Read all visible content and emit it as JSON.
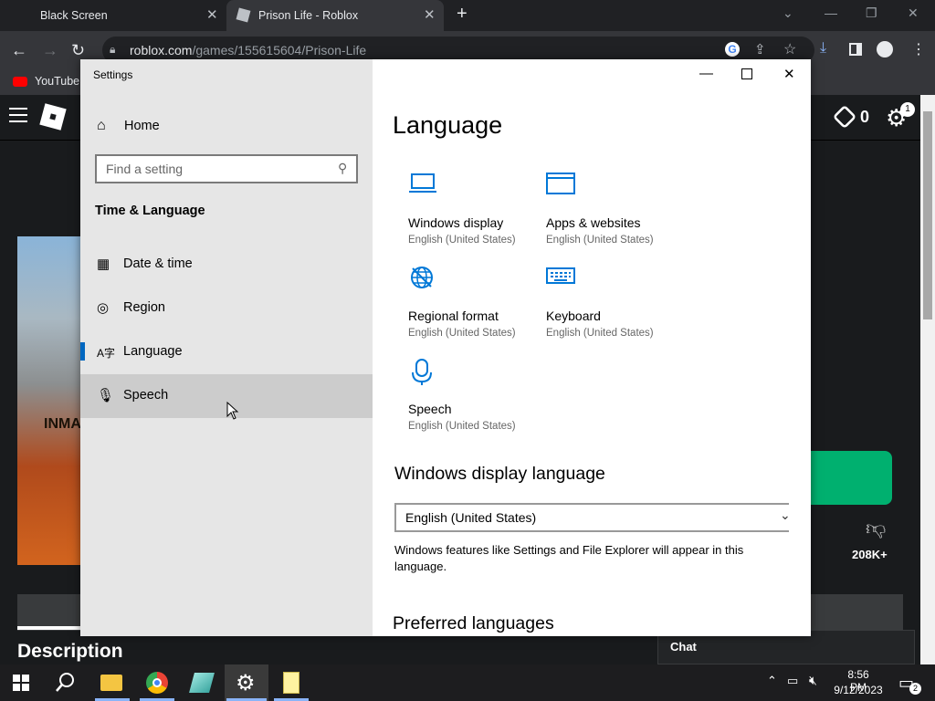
{
  "browser": {
    "tabs": [
      {
        "title": "Black Screen",
        "close": "✕"
      },
      {
        "title": "Prison Life - Roblox",
        "close": "✕"
      }
    ],
    "url_host": "roblox.com",
    "url_path": "/games/155615604/Prison-Life",
    "bookmark": "YouTube"
  },
  "roblox": {
    "robux": "0",
    "notification_count": "1",
    "game_overlay_text": "INMA",
    "dislikes": "208K+",
    "description_heading": "Description",
    "chat_label": "Chat"
  },
  "settings": {
    "window_title": "Settings",
    "home": "Home",
    "search_placeholder": "Find a setting",
    "group": "Time & Language",
    "nav": [
      {
        "label": "Date & time",
        "icon": "calendar-clock-icon"
      },
      {
        "label": "Region",
        "icon": "globe-icon"
      },
      {
        "label": "Language",
        "icon": "language-icon"
      },
      {
        "label": "Speech",
        "icon": "microphone-icon"
      }
    ],
    "selected_nav": "Language",
    "content_title": "Language",
    "tiles": [
      {
        "name": "Windows display",
        "sub": "English (United States)",
        "icon": "laptop-icon"
      },
      {
        "name": "Apps & websites",
        "sub": "English (United States)",
        "icon": "window-icon"
      },
      {
        "name": "Regional format",
        "sub": "English (United States)",
        "icon": "globe-format-icon"
      },
      {
        "name": "Keyboard",
        "sub": "English (United States)",
        "icon": "keyboard-icon"
      },
      {
        "name": "Speech",
        "sub": "English (United States)",
        "icon": "microphone-icon"
      }
    ],
    "display_language_title": "Windows display language",
    "display_language_value": "English (United States)",
    "display_language_desc": "Windows features like Settings and File Explorer will appear in this language.",
    "preferred_title": "Preferred languages"
  },
  "taskbar": {
    "time": "8:56 PM",
    "date": "9/12/2023",
    "notification_count": "2"
  },
  "colors": {
    "accent": "#0067c0",
    "tile_icon": "#0078d7",
    "play_green": "#00b06f"
  }
}
